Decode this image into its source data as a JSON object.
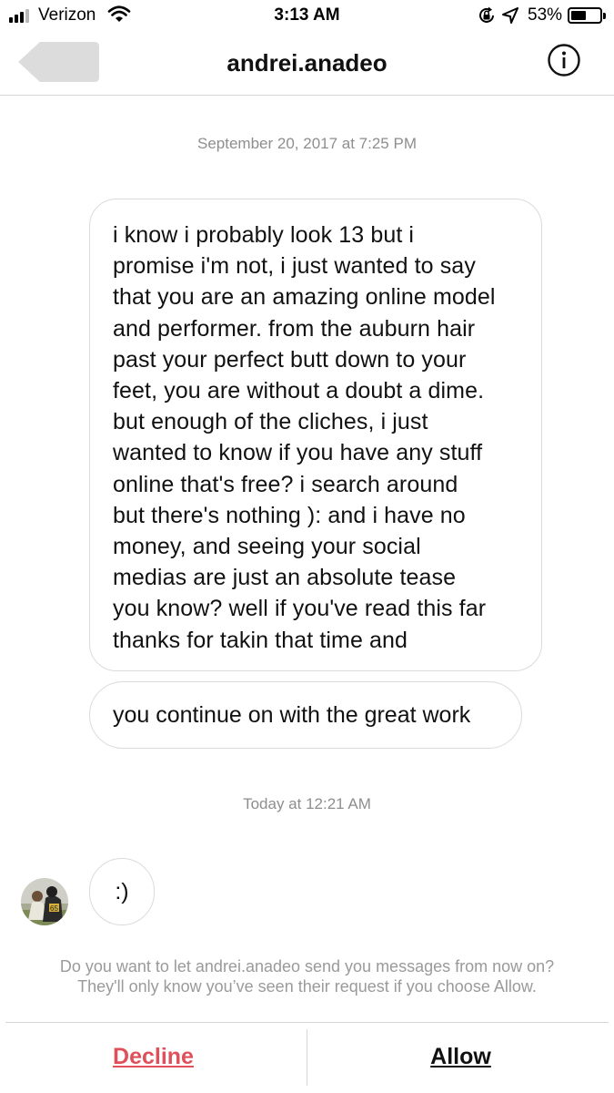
{
  "status_bar": {
    "carrier": "Verizon",
    "time": "3:13 AM",
    "battery_percent_label": "53%",
    "battery_level": 0.53,
    "signal_bars_filled": 3,
    "signal_bars_total": 4
  },
  "header": {
    "title": "andrei.anadeo",
    "back_icon": "back-arrow-icon",
    "info_icon": "info-icon"
  },
  "messages": {
    "timestamp_1": "September 20, 2017 at 7:25 PM",
    "message_1_lines": [
      "i know i probably look 13 but i",
      "promise i'm not, i just wanted to say",
      "that you are an amazing online model",
      "and performer. from the auburn hair",
      "past your perfect butt down to your",
      "feet, you are without a doubt a dime.",
      "but enough of the cliches, i just",
      "wanted to know if you have any stuff",
      "online that's free? i search around",
      "but there's nothing ): and i have no",
      "money, and seeing your social",
      "medias are just an absolute tease",
      "you know? well if you've read this far",
      "thanks for takin that time and"
    ],
    "message_2": "you continue on with the great work",
    "timestamp_2": "Today at 12:21 AM",
    "message_3": ":)"
  },
  "request": {
    "line_1": "Do you want to let andrei.anadeo send you messages from now on?",
    "line_2": "They'll only know you’ve seen their request if you choose Allow.",
    "decline_label": "Decline",
    "allow_label": "Allow"
  },
  "colors": {
    "decline": "#e0505a",
    "muted_text": "#8e8e8e",
    "bubble_border": "#dbdbdb"
  }
}
